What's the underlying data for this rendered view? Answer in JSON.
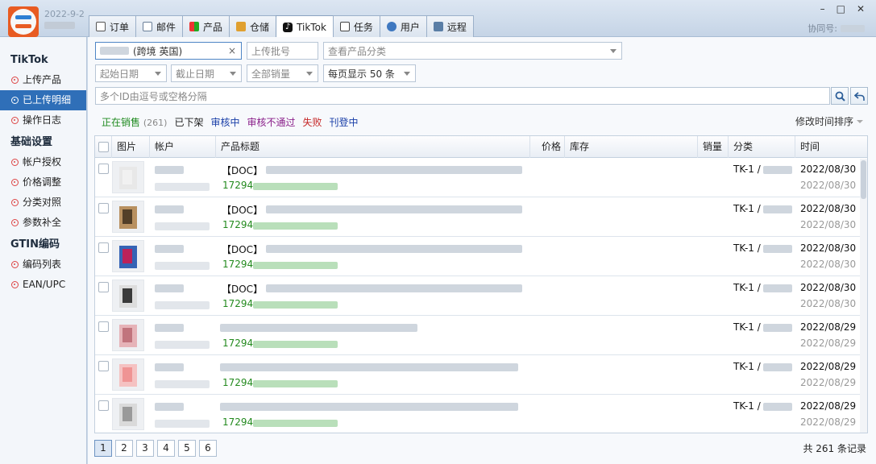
{
  "app": {
    "date": "2022-9-2",
    "coop_label": "协同号:",
    "win_min": "–",
    "win_max": "□",
    "win_close": "✕"
  },
  "tabs": [
    {
      "label": "订单",
      "icon": "order-icon",
      "active": false
    },
    {
      "label": "邮件",
      "icon": "mail-icon",
      "active": false
    },
    {
      "label": "产品",
      "icon": "product-icon",
      "active": false
    },
    {
      "label": "仓储",
      "icon": "warehouse-icon",
      "active": false
    },
    {
      "label": "TikTok",
      "icon": "tiktok-icon",
      "active": true
    },
    {
      "label": "任务",
      "icon": "task-icon",
      "active": false
    },
    {
      "label": "用户",
      "icon": "user-icon",
      "active": false
    },
    {
      "label": "远程",
      "icon": "remote-icon",
      "active": false
    }
  ],
  "sidebar": {
    "groups": [
      {
        "title": "TikTok",
        "items": [
          {
            "label": "上传产品",
            "active": false
          },
          {
            "label": "已上传明细",
            "active": true
          },
          {
            "label": "操作日志",
            "active": false
          }
        ]
      },
      {
        "title": "基础设置",
        "items": [
          {
            "label": "帐户授权",
            "active": false
          },
          {
            "label": "价格调整",
            "active": false
          },
          {
            "label": "分类对照",
            "active": false
          },
          {
            "label": "参数补全",
            "active": false
          }
        ]
      },
      {
        "title": "GTIN编码",
        "items": [
          {
            "label": "编码列表",
            "active": false
          },
          {
            "label": "EAN/UPC",
            "active": false
          }
        ]
      }
    ]
  },
  "filters": {
    "shop_value": "(跨境 英国)",
    "batch_placeholder": "上传批号",
    "category_placeholder": "查看产品分类",
    "start_date": "起始日期",
    "end_date": "截止日期",
    "sales": "全部销量",
    "page_size": "每页显示 50 条",
    "id_search_placeholder": "多个ID由逗号或空格分隔"
  },
  "status_tabs": {
    "on_sale": "正在销售",
    "on_sale_count": "(261)",
    "off_shelf": "已下架",
    "reviewing": "审核中",
    "rejected": "审核不通过",
    "failed": "失败",
    "publishing": "刊登中",
    "colors": {
      "on_sale": "#1f8a1f",
      "off_shelf": "#222222",
      "reviewing": "#1a3fa8",
      "rejected": "#8a1f8a",
      "failed": "#c62828",
      "publishing": "#1a3fa8"
    }
  },
  "sort_label": "修改时间排序",
  "table": {
    "headers": {
      "image": "图片",
      "account": "帐户",
      "title": "产品标题",
      "price": "价格",
      "stock": "库存",
      "sales": "销量",
      "category": "分类",
      "time": "时间"
    },
    "rows": [
      {
        "doc": "【DOC】",
        "sku": "17294",
        "category": "TK-1 /",
        "date1": "2022/08/30",
        "date2": "2022/08/30"
      },
      {
        "doc": "【DOC】",
        "sku": "17294",
        "category": "TK-1 /",
        "date1": "2022/08/30",
        "date2": "2022/08/30"
      },
      {
        "doc": "【DOC】",
        "sku": "17294",
        "category": "TK-1 /",
        "date1": "2022/08/30",
        "date2": "2022/08/30"
      },
      {
        "doc": "【DOC】",
        "sku": "17294",
        "category": "TK-1 /",
        "date1": "2022/08/30",
        "date2": "2022/08/30"
      },
      {
        "doc": "",
        "sku": "17294",
        "category": "TK-1 /",
        "date1": "2022/08/29",
        "date2": "2022/08/29"
      },
      {
        "doc": "",
        "sku": "17294",
        "category": "TK-1 /",
        "date1": "2022/08/29",
        "date2": "2022/08/29"
      },
      {
        "doc": "",
        "sku": "17294",
        "category": "TK-1 /",
        "date1": "2022/08/29",
        "date2": "2022/08/29"
      }
    ]
  },
  "pagination": {
    "pages": [
      "1",
      "2",
      "3",
      "4",
      "5",
      "6"
    ],
    "current": "1",
    "total": "共 261 条记录"
  }
}
